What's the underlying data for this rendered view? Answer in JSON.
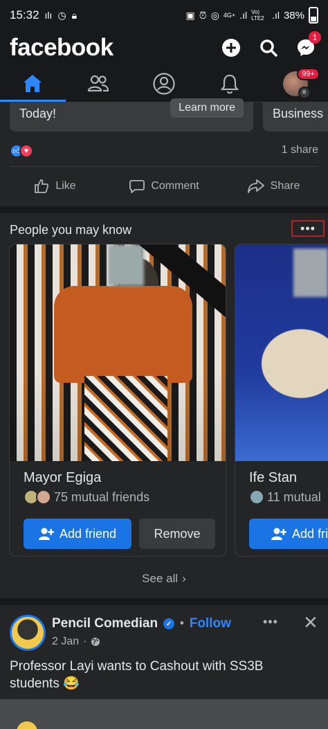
{
  "status_bar": {
    "time": "15:32",
    "network_labels": [
      "4G+",
      "Vo) LTE2"
    ],
    "battery": "38%"
  },
  "header": {
    "brand": "facebook",
    "messenger_badge": "1",
    "icons": [
      "plus-icon",
      "search-icon",
      "messenger-icon"
    ]
  },
  "nav": {
    "tabs": [
      "home",
      "friends",
      "profile",
      "notifications",
      "menu"
    ],
    "menu_badge": "99+"
  },
  "top_post": {
    "ad_text_left": "Today!",
    "ad_button": "Learn more",
    "ad_text_right": "Business",
    "share_count": "1 share",
    "actions": {
      "like": "Like",
      "comment": "Comment",
      "share": "Share"
    }
  },
  "pymk": {
    "title": "People you may know",
    "more": "•••",
    "cards": [
      {
        "name": "Mayor Egiga",
        "mutual": "75 mutual friends",
        "add": "Add friend",
        "remove": "Remove"
      },
      {
        "name": "Ife Stan",
        "mutual": "11 mutual",
        "add": "Add frie"
      }
    ],
    "see_all": "See all"
  },
  "post2": {
    "author": "Pencil Comedian",
    "separator": "•",
    "follow": "Follow",
    "date": "2 Jan",
    "more": "•••",
    "close": "✕",
    "text": "Professor Layi wants to Cashout with SS3B students 😂"
  },
  "colors": {
    "accent": "#1b74e4",
    "badge": "#e41e3f",
    "background": "#18191a",
    "card": "#242526"
  }
}
